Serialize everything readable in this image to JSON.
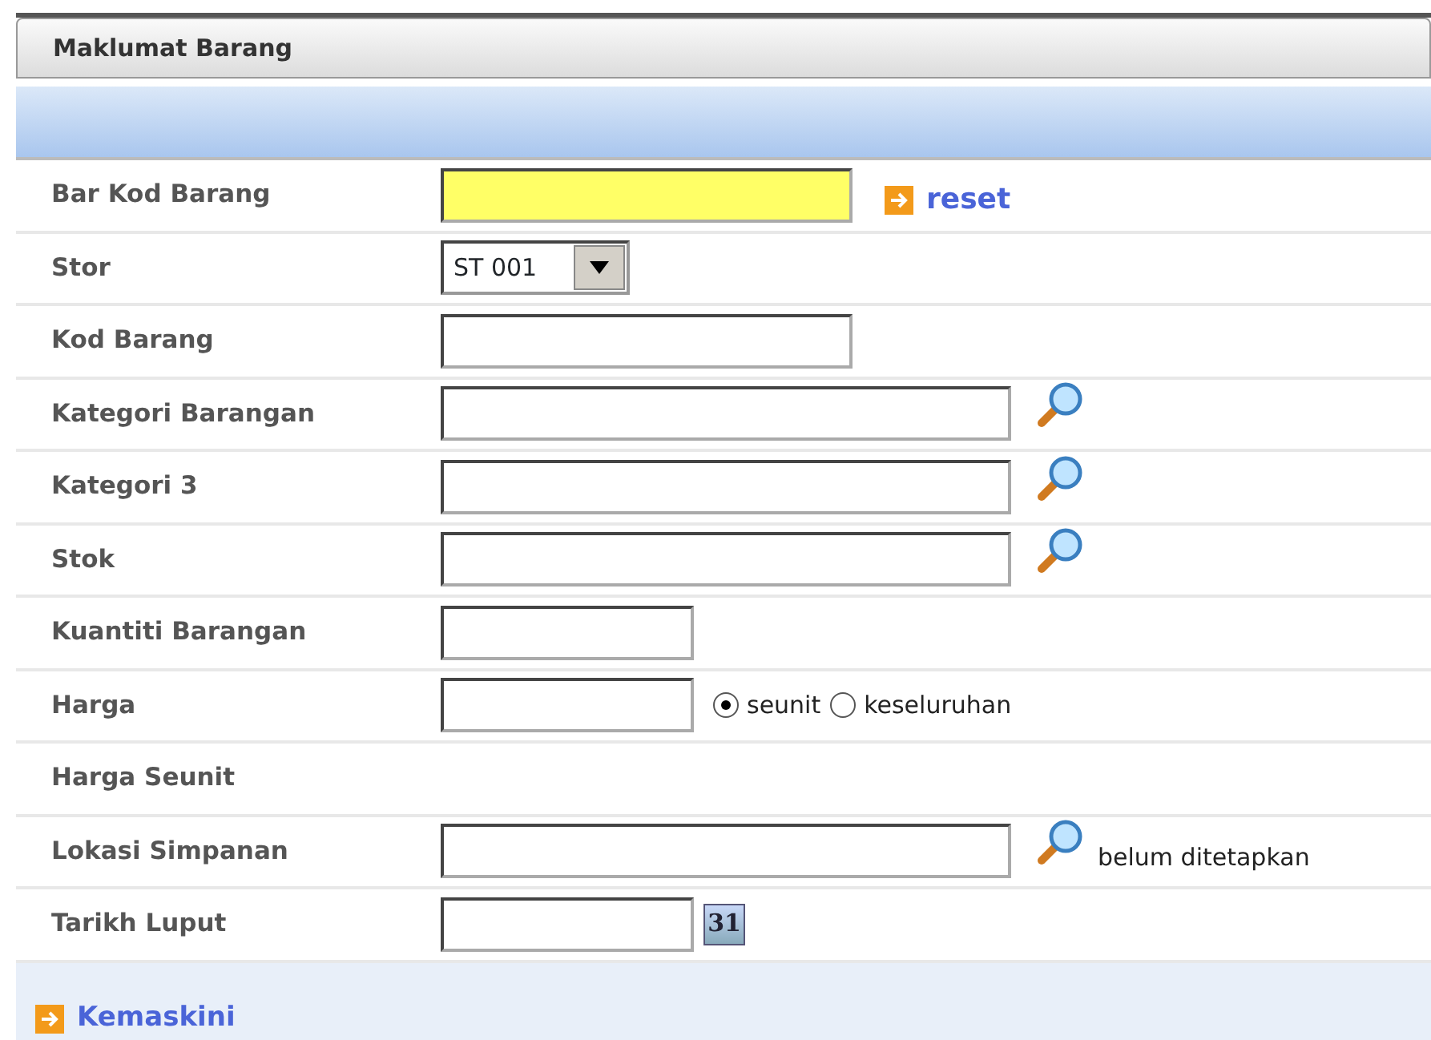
{
  "panel": {
    "title": "Maklumat Barang"
  },
  "rows": [
    {
      "label": "Bar Kod Barang",
      "kind": "text",
      "focused": true,
      "action": "reset"
    },
    {
      "label": "Stor",
      "kind": "select",
      "value": "ST 001"
    },
    {
      "label": "Kod Barang",
      "kind": "text",
      "focused": false
    },
    {
      "label": "Kategori Barangan",
      "kind": "long-text",
      "focused": false,
      "lookup": true
    },
    {
      "label": "Kategori 3",
      "kind": "long-text",
      "focused": false,
      "lookup": true
    },
    {
      "label": "Stok",
      "kind": "long-text",
      "focused": false,
      "lookup": true
    },
    {
      "label": "Kuantiti Barangan",
      "kind": "short-text",
      "focused": false
    },
    {
      "label": "Harga",
      "kind": "short-text",
      "focused": false,
      "radios": [
        {
          "label": "seunit",
          "selected": true
        },
        {
          "label": "keseluruhan",
          "selected": false
        }
      ]
    },
    {
      "label": "Harga Seunit",
      "kind": "none"
    },
    {
      "label": "Lokasi Simpanan",
      "kind": "long-text",
      "focused": false,
      "lookup": true,
      "note": "belum ditetapkan"
    },
    {
      "label": "Tarikh Luput",
      "kind": "short-text",
      "focused": false,
      "calendar": "31"
    }
  ],
  "footer": {
    "link": "Kemaskini"
  }
}
